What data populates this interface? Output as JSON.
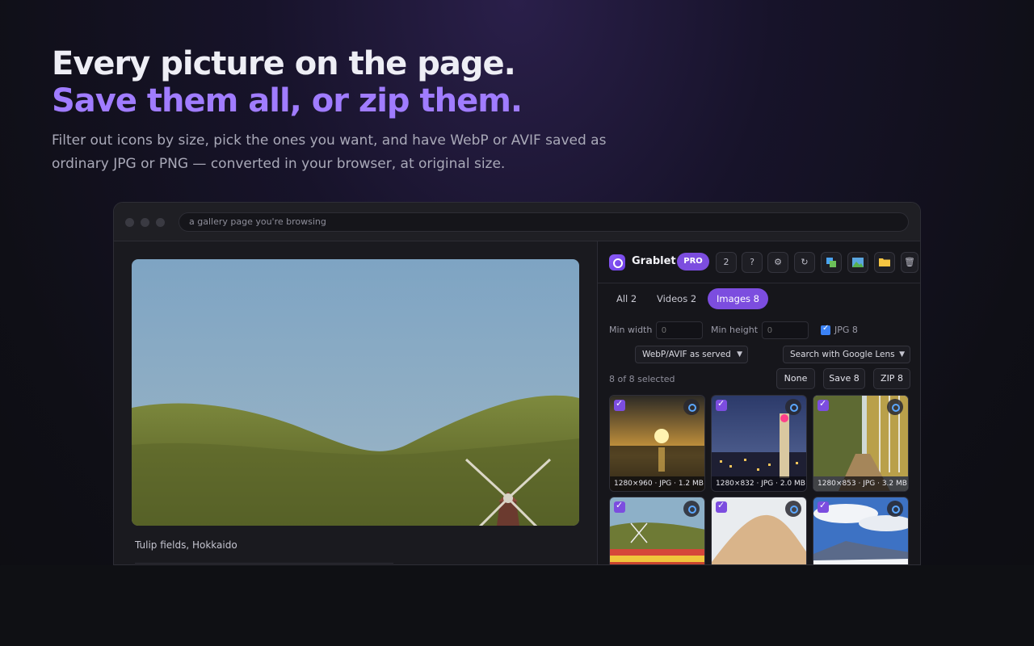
{
  "hero": {
    "headline_line1": "Every picture on the page.",
    "headline_line2": "Save them all, or zip them.",
    "description": "Filter out icons by size, pick the ones you want, and have WebP or AVIF saved as ordinary JPG or PNG — converted in your browser, at original size."
  },
  "browser": {
    "address_bar": "a gallery page you're browsing"
  },
  "page": {
    "caption": "Tulip fields, Hokkaido"
  },
  "extension": {
    "brand": "Grablet",
    "badge": "PRO",
    "count_button": "2",
    "help_button": "?",
    "toolbar_icons": [
      "gear-icon",
      "refresh-icon",
      "copy-images-icon",
      "image-icon",
      "folder-icon",
      "trash-icon"
    ],
    "tabs": [
      {
        "label": "All 2",
        "active": false
      },
      {
        "label": "Videos 2",
        "active": false
      },
      {
        "label": "Images 8",
        "active": true
      }
    ],
    "filters": {
      "min_width_label": "Min width",
      "min_width_placeholder": "0",
      "min_height_label": "Min height",
      "min_height_placeholder": "0",
      "jpg_checkbox_label": "JPG 8",
      "jpg_checked": true,
      "format_select": "WebP/AVIF as served",
      "search_select": "Search with Google Lens"
    },
    "selection": {
      "count_text": "8 of 8 selected",
      "none_button": "None",
      "save_button": "Save 8",
      "zip_button": "ZIP 8"
    },
    "thumbnails": [
      {
        "scene": "sunset over lake",
        "meta": "1280×960 · JPG · 1.2 MB",
        "checked": true
      },
      {
        "scene": "city tower at night",
        "meta": "1280×832 · JPG · 2.0 MB",
        "checked": true
      },
      {
        "scene": "autumn forest path",
        "meta": "1280×853 · JPG · 3.2 MB",
        "checked": true
      },
      {
        "scene": "windmill tulip field",
        "meta": "",
        "checked": true
      },
      {
        "scene": "sand dunes",
        "meta": "",
        "checked": true
      },
      {
        "scene": "snowy mountain under clouds",
        "meta": "",
        "checked": true
      }
    ]
  },
  "colors": {
    "accent": "#7c4ddf",
    "headline_accent": "#a07cff",
    "checkbox_blue": "#3b82f6"
  }
}
